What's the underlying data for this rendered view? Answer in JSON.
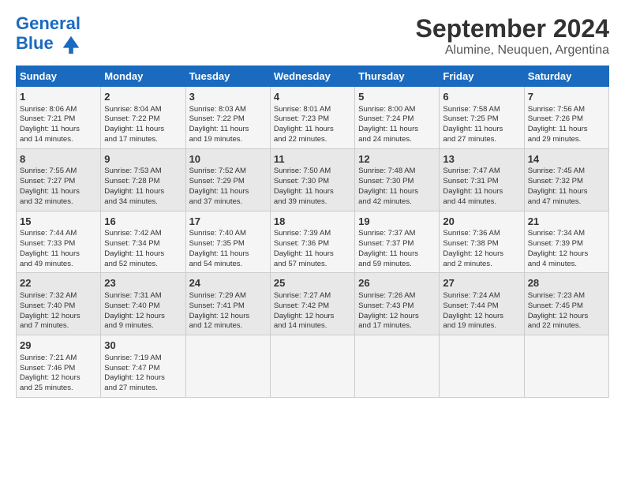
{
  "logo": {
    "line1": "General",
    "line2": "Blue"
  },
  "title": "September 2024",
  "subtitle": "Alumine, Neuquen, Argentina",
  "days_of_week": [
    "Sunday",
    "Monday",
    "Tuesday",
    "Wednesday",
    "Thursday",
    "Friday",
    "Saturday"
  ],
  "weeks": [
    [
      {
        "day": 1,
        "data": "Sunrise: 8:06 AM\nSunset: 7:21 PM\nDaylight: 11 hours\nand 14 minutes."
      },
      {
        "day": 2,
        "data": "Sunrise: 8:04 AM\nSunset: 7:22 PM\nDaylight: 11 hours\nand 17 minutes."
      },
      {
        "day": 3,
        "data": "Sunrise: 8:03 AM\nSunset: 7:22 PM\nDaylight: 11 hours\nand 19 minutes."
      },
      {
        "day": 4,
        "data": "Sunrise: 8:01 AM\nSunset: 7:23 PM\nDaylight: 11 hours\nand 22 minutes."
      },
      {
        "day": 5,
        "data": "Sunrise: 8:00 AM\nSunset: 7:24 PM\nDaylight: 11 hours\nand 24 minutes."
      },
      {
        "day": 6,
        "data": "Sunrise: 7:58 AM\nSunset: 7:25 PM\nDaylight: 11 hours\nand 27 minutes."
      },
      {
        "day": 7,
        "data": "Sunrise: 7:56 AM\nSunset: 7:26 PM\nDaylight: 11 hours\nand 29 minutes."
      }
    ],
    [
      {
        "day": 8,
        "data": "Sunrise: 7:55 AM\nSunset: 7:27 PM\nDaylight: 11 hours\nand 32 minutes."
      },
      {
        "day": 9,
        "data": "Sunrise: 7:53 AM\nSunset: 7:28 PM\nDaylight: 11 hours\nand 34 minutes."
      },
      {
        "day": 10,
        "data": "Sunrise: 7:52 AM\nSunset: 7:29 PM\nDaylight: 11 hours\nand 37 minutes."
      },
      {
        "day": 11,
        "data": "Sunrise: 7:50 AM\nSunset: 7:30 PM\nDaylight: 11 hours\nand 39 minutes."
      },
      {
        "day": 12,
        "data": "Sunrise: 7:48 AM\nSunset: 7:30 PM\nDaylight: 11 hours\nand 42 minutes."
      },
      {
        "day": 13,
        "data": "Sunrise: 7:47 AM\nSunset: 7:31 PM\nDaylight: 11 hours\nand 44 minutes."
      },
      {
        "day": 14,
        "data": "Sunrise: 7:45 AM\nSunset: 7:32 PM\nDaylight: 11 hours\nand 47 minutes."
      }
    ],
    [
      {
        "day": 15,
        "data": "Sunrise: 7:44 AM\nSunset: 7:33 PM\nDaylight: 11 hours\nand 49 minutes."
      },
      {
        "day": 16,
        "data": "Sunrise: 7:42 AM\nSunset: 7:34 PM\nDaylight: 11 hours\nand 52 minutes."
      },
      {
        "day": 17,
        "data": "Sunrise: 7:40 AM\nSunset: 7:35 PM\nDaylight: 11 hours\nand 54 minutes."
      },
      {
        "day": 18,
        "data": "Sunrise: 7:39 AM\nSunset: 7:36 PM\nDaylight: 11 hours\nand 57 minutes."
      },
      {
        "day": 19,
        "data": "Sunrise: 7:37 AM\nSunset: 7:37 PM\nDaylight: 11 hours\nand 59 minutes."
      },
      {
        "day": 20,
        "data": "Sunrise: 7:36 AM\nSunset: 7:38 PM\nDaylight: 12 hours\nand 2 minutes."
      },
      {
        "day": 21,
        "data": "Sunrise: 7:34 AM\nSunset: 7:39 PM\nDaylight: 12 hours\nand 4 minutes."
      }
    ],
    [
      {
        "day": 22,
        "data": "Sunrise: 7:32 AM\nSunset: 7:40 PM\nDaylight: 12 hours\nand 7 minutes."
      },
      {
        "day": 23,
        "data": "Sunrise: 7:31 AM\nSunset: 7:40 PM\nDaylight: 12 hours\nand 9 minutes."
      },
      {
        "day": 24,
        "data": "Sunrise: 7:29 AM\nSunset: 7:41 PM\nDaylight: 12 hours\nand 12 minutes."
      },
      {
        "day": 25,
        "data": "Sunrise: 7:27 AM\nSunset: 7:42 PM\nDaylight: 12 hours\nand 14 minutes."
      },
      {
        "day": 26,
        "data": "Sunrise: 7:26 AM\nSunset: 7:43 PM\nDaylight: 12 hours\nand 17 minutes."
      },
      {
        "day": 27,
        "data": "Sunrise: 7:24 AM\nSunset: 7:44 PM\nDaylight: 12 hours\nand 19 minutes."
      },
      {
        "day": 28,
        "data": "Sunrise: 7:23 AM\nSunset: 7:45 PM\nDaylight: 12 hours\nand 22 minutes."
      }
    ],
    [
      {
        "day": 29,
        "data": "Sunrise: 7:21 AM\nSunset: 7:46 PM\nDaylight: 12 hours\nand 25 minutes."
      },
      {
        "day": 30,
        "data": "Sunrise: 7:19 AM\nSunset: 7:47 PM\nDaylight: 12 hours\nand 27 minutes."
      },
      {
        "day": null,
        "data": ""
      },
      {
        "day": null,
        "data": ""
      },
      {
        "day": null,
        "data": ""
      },
      {
        "day": null,
        "data": ""
      },
      {
        "day": null,
        "data": ""
      }
    ]
  ]
}
